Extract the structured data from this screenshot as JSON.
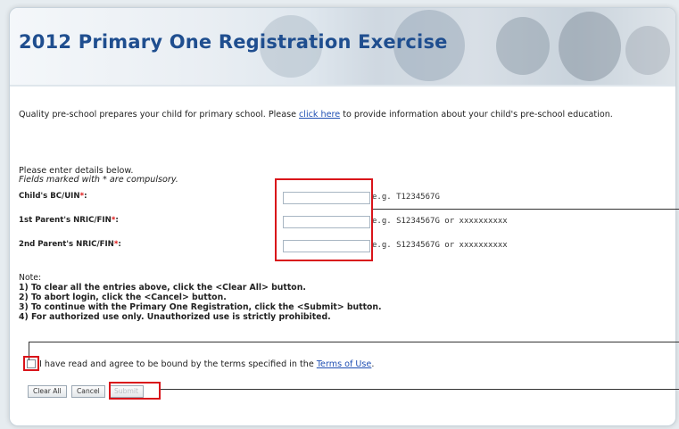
{
  "banner": {
    "title": "2012 Primary One Registration Exercise"
  },
  "intro": {
    "before_link": "Quality pre-school prepares your child for primary school. Please ",
    "link": "click here",
    "after_link": " to provide information about your child's pre-school education."
  },
  "form": {
    "instruction": "Please enter details below.",
    "compulsory_note": "Fields marked with * are compulsory.",
    "fields": [
      {
        "label": "Child's BC/UIN",
        "required_mark": "*",
        "suffix": ":",
        "value": "",
        "hint": "e.g. T1234567G"
      },
      {
        "label": "1st Parent's NRIC/FIN",
        "required_mark": "*",
        "suffix": ":",
        "value": "",
        "hint": "e.g. S1234567G or xxxxxxxxxx"
      },
      {
        "label": "2nd Parent's NRIC/FIN",
        "required_mark": "*",
        "suffix": ":",
        "value": "",
        "hint": "e.g. S1234567G or xxxxxxxxxx"
      }
    ]
  },
  "notes": {
    "title": "Note:",
    "items": [
      "1)   To clear all the entries above, click the <Clear All> button.",
      "2)   To abort login, click the <Cancel> button.",
      "3)   To continue with the Primary One Registration, click the <Submit> button.",
      "4)   For authorized use only. Unauthorized use is strictly prohibited."
    ]
  },
  "agreement": {
    "text": "I have read and agree to be bound by the terms specified in the ",
    "link": "Terms of Use",
    "end": ".",
    "checked": false
  },
  "buttons": {
    "clear_all": "Clear All",
    "cancel": "Cancel",
    "submit": "Submit"
  },
  "colors": {
    "title": "#1f4e8f",
    "link": "#1f4fb3",
    "required": "#dd1111",
    "highlight": "#d9141a"
  }
}
